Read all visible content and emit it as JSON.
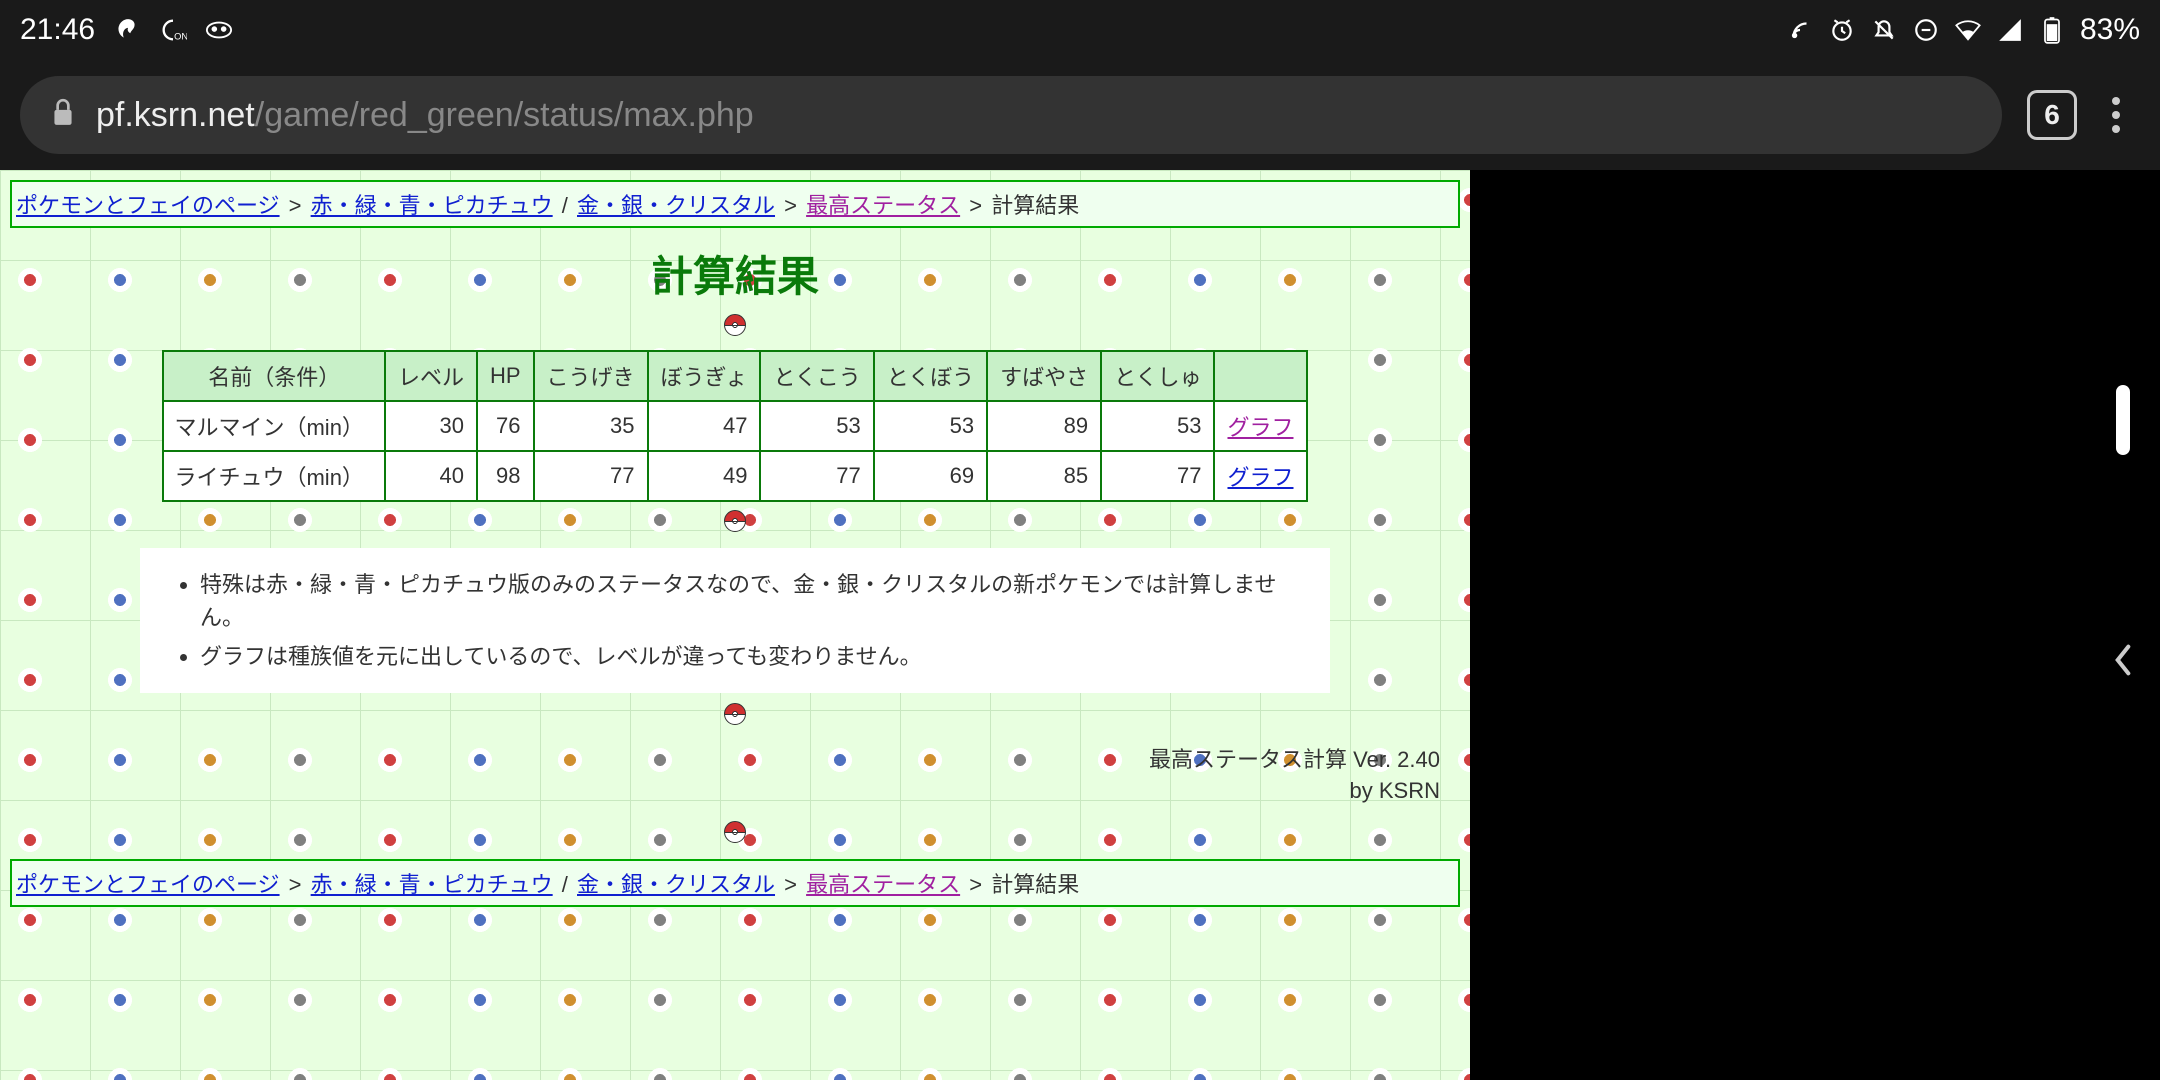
{
  "status_bar": {
    "time": "21:46",
    "battery": "83%"
  },
  "browser": {
    "url_domain": "pf.ksrn.net",
    "url_path": "/game/red_green/status/max.php",
    "tab_count": "6"
  },
  "breadcrumb": {
    "items": [
      {
        "label": "ポケモンとフェイのページ",
        "link": true,
        "visited": false
      },
      {
        "sep": ">"
      },
      {
        "label": "赤・緑・青・ピカチュウ",
        "link": true,
        "visited": false
      },
      {
        "sep": "/"
      },
      {
        "label": "金・銀・クリスタル",
        "link": true,
        "visited": false
      },
      {
        "sep": ">"
      },
      {
        "label": "最高ステータス",
        "link": true,
        "visited": true
      },
      {
        "sep": ">"
      },
      {
        "label": "計算結果",
        "link": false
      }
    ]
  },
  "page": {
    "title": "計算結果",
    "table": {
      "headers": [
        "名前（条件）",
        "レベル",
        "HP",
        "こうげき",
        "ぼうぎょ",
        "とくこう",
        "とくぼう",
        "すばやさ",
        "とくしゅ",
        ""
      ],
      "rows": [
        {
          "name": "マルマイン（min）",
          "level": "30",
          "hp": "76",
          "atk": "35",
          "def": "47",
          "spa": "53",
          "spd": "53",
          "spe": "89",
          "spc": "53",
          "link": "グラフ",
          "visited": true
        },
        {
          "name": "ライチュウ（min）",
          "level": "40",
          "hp": "98",
          "atk": "77",
          "def": "49",
          "spa": "77",
          "spd": "69",
          "spe": "85",
          "spc": "77",
          "link": "グラフ",
          "visited": false
        }
      ]
    },
    "notes": [
      "特殊は赤・緑・青・ピカチュウ版のみのステータスなので、金・銀・クリスタルの新ポケモンでは計算しません。",
      "グラフは種族値を元に出しているので、レベルが違っても変わりません。"
    ],
    "footer": {
      "line1": "最高ステータス計算 Ver. 2.40",
      "line2": "by KSRN"
    }
  }
}
